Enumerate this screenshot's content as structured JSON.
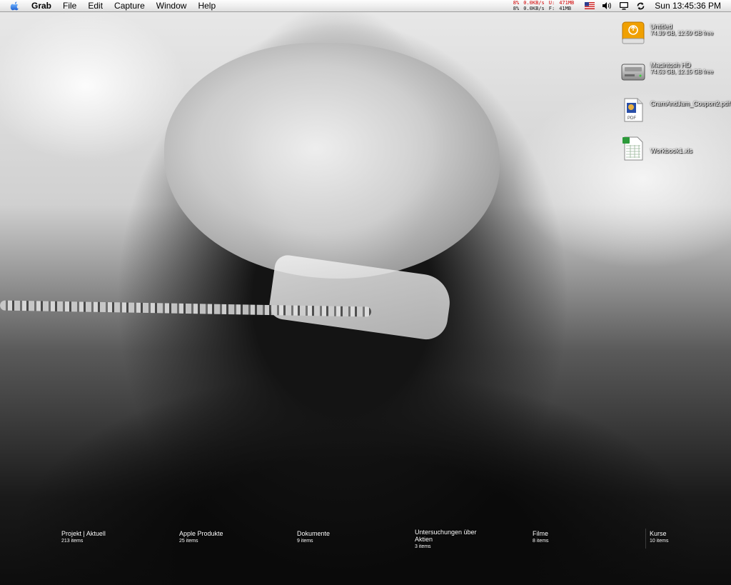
{
  "menubar": {
    "app_name": "Grab",
    "items": [
      "File",
      "Edit",
      "Capture",
      "Window",
      "Help"
    ],
    "stats": {
      "cpu_top": "8%",
      "cpu_bottom": "8%",
      "net_in": "0.0KB/s",
      "net_out": "0.0KB/s",
      "mem_used_label": "U:",
      "mem_used": "471MB",
      "mem_free_label": "F:",
      "mem_free": "41MB"
    },
    "clock": "Sun 13:45:36 PM"
  },
  "desktop_icons": [
    {
      "name": "Untitled",
      "sub": "74.39 GB, 12.59 GB free",
      "icon": "external-drive-icon"
    },
    {
      "name": "Macintosh HD",
      "sub": "74.53 GB, 12.15 GB free",
      "icon": "hard-drive-icon"
    },
    {
      "name": "CramAndJam_Coupon2.pdf",
      "sub": "",
      "icon": "pdf-file-icon"
    },
    {
      "name": "Workbook1.xls",
      "sub": "",
      "icon": "spreadsheet-file-icon"
    }
  ],
  "dock_folders": [
    {
      "name": "Projekt | Aktuell",
      "count": "213 items"
    },
    {
      "name": "Apple Produkte",
      "count": "25 items"
    },
    {
      "name": "Dokumente",
      "count": "9 items"
    },
    {
      "name": "Untersuchungen über Aktien",
      "count": "3 items"
    },
    {
      "name": "Filme",
      "count": "8 items"
    },
    {
      "name": "Kurse",
      "count": "10 items"
    }
  ],
  "colors": {
    "stat_alert": "#d00000",
    "drive_orange": "#f0a000"
  }
}
